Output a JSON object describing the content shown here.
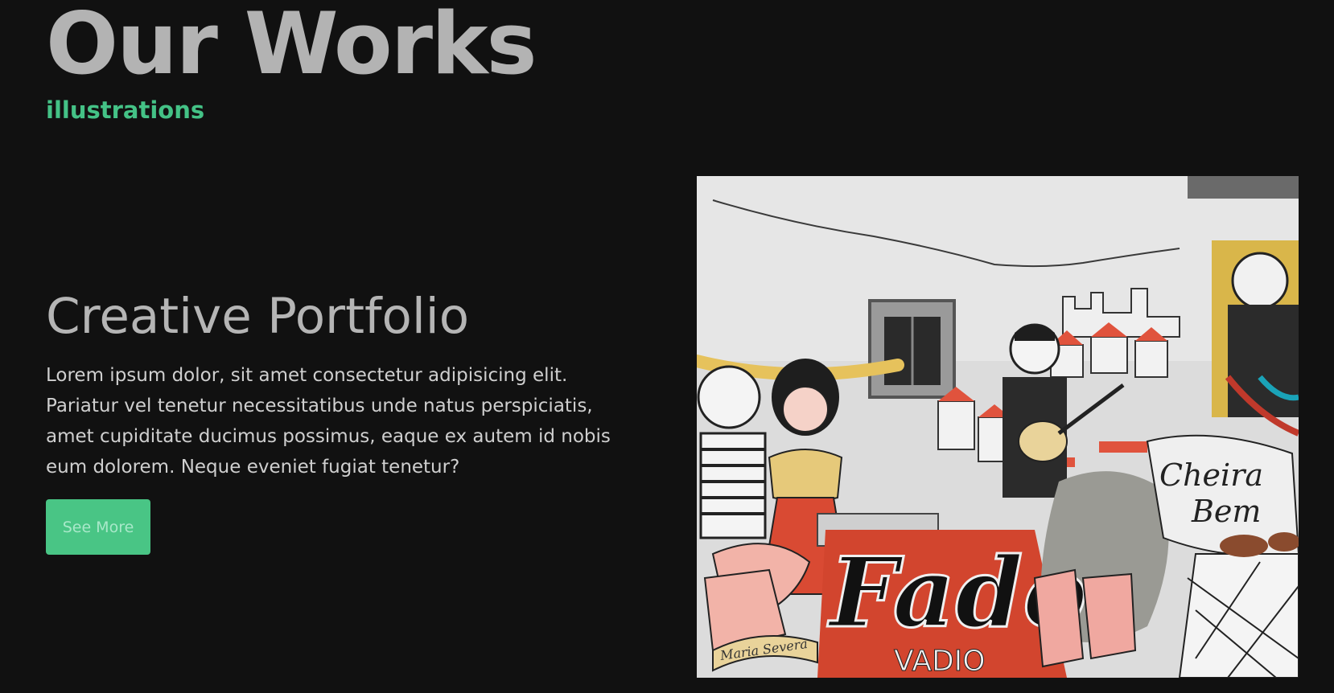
{
  "header": {
    "title": "Our Works",
    "subtitle": "illustrations"
  },
  "feature": {
    "heading": "Creative Portfolio",
    "body": "Lorem ipsum dolor, sit amet consectetur adipisicing elit. Pariatur vel tenetur necessitatibus unde natus perspiciatis, amet cupiditate ducimus possimus, eaque ex autem id nobis eum dolorem. Neque eveniet fugiat tenetur?",
    "button_label": "See More"
  },
  "artwork": {
    "lettering_main": "Fado",
    "lettering_secondary": "VADIO",
    "lettering_script_1": "Cheira",
    "lettering_script_2": "Bem",
    "lettering_banner": "Maria Severa"
  },
  "colors": {
    "background": "#111111",
    "heading_gray": "#b3b3b3",
    "accent_green": "#44c286",
    "button_green": "#49c585"
  }
}
